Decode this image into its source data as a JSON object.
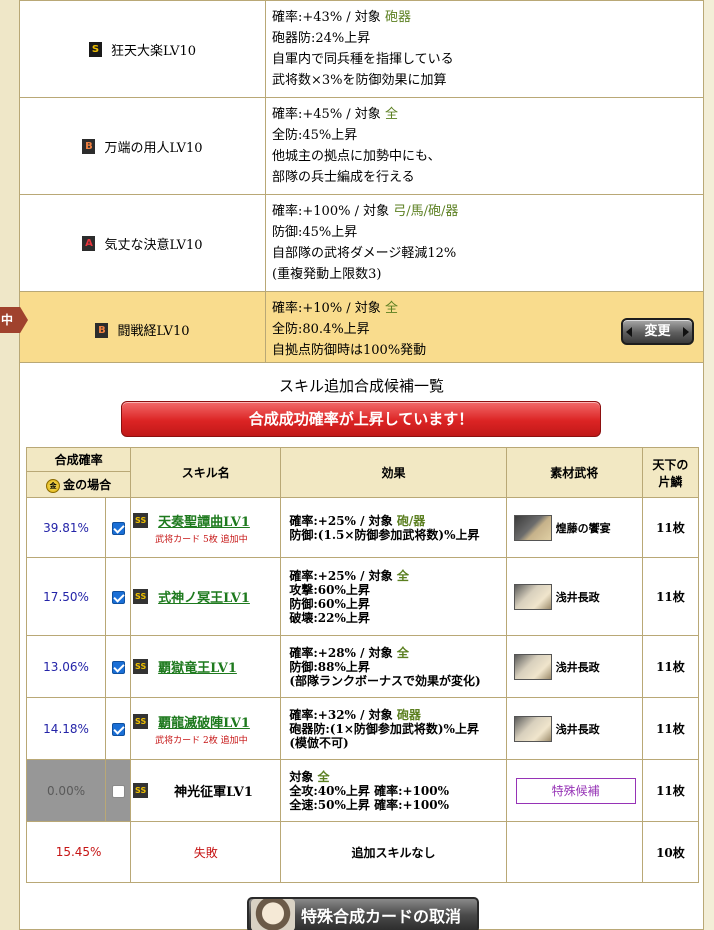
{
  "current_skills": [
    {
      "rank": "S",
      "name": "狂天大楽LV10",
      "effects": [
        "確率:+43% / 対象 |砲器",
        "砲器防:24%上昇",
        "自軍内で同兵種を指揮している",
        "武将数×3%を防御効果に加算"
      ]
    },
    {
      "rank": "B",
      "name": "万端の用人LV10",
      "effects": [
        "確率:+45% / 対象 |全",
        "全防:45%上昇",
        "他城主の拠点に加勢中にも、",
        "部隊の兵士編成を行える"
      ]
    },
    {
      "rank": "A",
      "name": "気丈な決意LV10",
      "effects": [
        "確率:+100% / 対象 |弓/馬/砲/器",
        "防御:45%上昇",
        "自部隊の武将ダメージ軽減12%",
        "(重複発動上限数3)"
      ]
    },
    {
      "rank": "B",
      "name": "闘戦経LV10",
      "effects": [
        "確率:+10% / 対象 |全",
        "全防:80.4%上昇",
        "自拠点防御時は100%発動"
      ],
      "selected": true
    }
  ],
  "current_marker": "中",
  "change_label": "変更",
  "panel": {
    "title": "スキル追加合成候補一覧",
    "banner": "合成成功確率が上昇しています！",
    "headers": {
      "rate": "合成確率",
      "gold_icon": "金",
      "gold_label": "金の場合",
      "skill": "スキル名",
      "effect": "効果",
      "material": "素材武将",
      "count_line1": "天下の",
      "count_line2": "片鱗"
    },
    "rows": [
      {
        "rate": "39.81%",
        "checked": true,
        "rank": "SS",
        "skill": "天奏聖譚曲LV1",
        "card_note": "武将カード 5枚 追加中",
        "effects": [
          "確率:+25% / 対象 |砲/器",
          "防御:(1.5×防御参加武将数)%上昇"
        ],
        "material": "煌藤の饗宴",
        "count": "11枚"
      },
      {
        "rate": "17.50%",
        "checked": true,
        "rank": "SS",
        "skill": "式神ノ冥王LV1",
        "card_note": "",
        "effects": [
          "確率:+25% / 対象 |全",
          "攻撃:60%上昇",
          "防御:60%上昇",
          "破壊:22%上昇"
        ],
        "material": "浅井長政",
        "count": "11枚"
      },
      {
        "rate": "13.06%",
        "checked": true,
        "rank": "SS",
        "skill": "覇獄竜王LV1",
        "card_note": "",
        "effects": [
          "確率:+28% / 対象 |全",
          "防御:88%上昇",
          "(部隊ランクボーナスで効果が変化)"
        ],
        "material": "浅井長政",
        "count": "11枚"
      },
      {
        "rate": "14.18%",
        "checked": true,
        "rank": "SS",
        "skill": "覇龍滅破陣LV1",
        "card_note": "武将カード 2枚 追加中",
        "effects": [
          "確率:+32% / 対象 |砲器",
          "砲器防:(1×防御参加武将数)%上昇",
          "(模倣不可)"
        ],
        "material": "浅井長政",
        "count": "11枚"
      },
      {
        "rate": "0.00%",
        "checked": false,
        "rank": "SS",
        "skill": "神光征軍LV1",
        "card_note": "",
        "effects": [
          "対象 |全",
          "全攻:40%上昇 確率:+100%",
          "全速:50%上昇 確率:+100%"
        ],
        "special_label": "特殊候補",
        "count": "11枚",
        "disabled": true
      }
    ],
    "fail_row": {
      "rate": "15.45%",
      "label": "失敗",
      "note": "追加スキルなし",
      "count": "10枚"
    },
    "cancel_label": "特殊合成カードの取消"
  }
}
